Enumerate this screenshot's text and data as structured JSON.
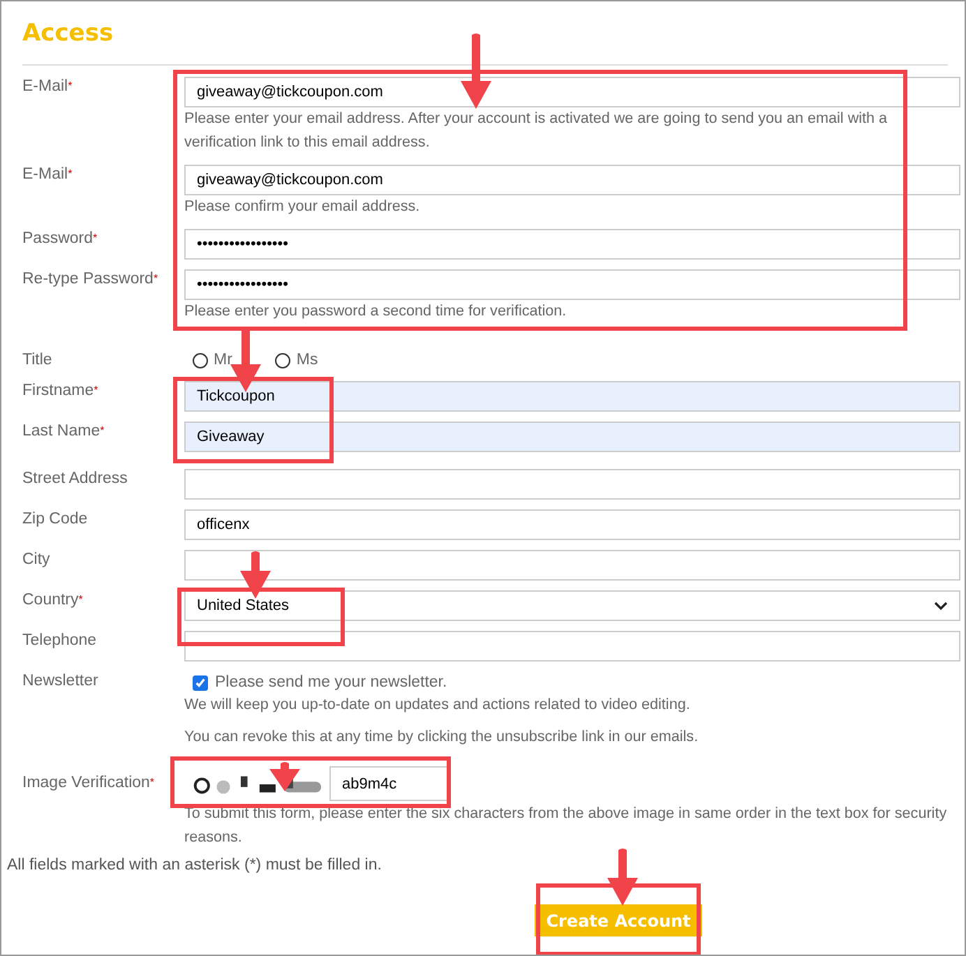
{
  "heading": "Access",
  "fields": [
    {
      "kind": "text",
      "label": "E-Mail",
      "asterisk": "*",
      "value": "giveaway@tickcoupon.com",
      "help": [
        "Please enter your email address. After your account is activated we are going to send you an email with a verification link to this email address."
      ]
    },
    {
      "kind": "text",
      "label": "E-Mail",
      "asterisk": "*",
      "value": "giveaway@tickcoupon.com",
      "help": [
        "Please confirm your email address."
      ]
    },
    {
      "kind": "password",
      "label": "Password",
      "asterisk": "*",
      "value": "•••••••••••••••••"
    },
    {
      "kind": "password",
      "label": "Re-type Password",
      "asterisk": "*",
      "value": "•••••••••••••••••",
      "help": [
        "Please enter you password a second time for verification."
      ]
    },
    {
      "kind": "radio",
      "label": "Title",
      "options": [
        {
          "label": "Mr",
          "selected": false
        },
        {
          "label": "Ms",
          "selected": false
        }
      ]
    },
    {
      "kind": "text",
      "label": "Firstname",
      "asterisk": "*",
      "value": "Tickcoupon",
      "autofilled": true
    },
    {
      "kind": "text",
      "label": "Last Name",
      "asterisk": "*",
      "value": "Giveaway",
      "autofilled": true
    },
    {
      "kind": "text",
      "label": "Street Address",
      "gap": true
    },
    {
      "kind": "text",
      "label": "Zip Code",
      "value": "officenx"
    },
    {
      "kind": "text",
      "label": "City"
    },
    {
      "kind": "select",
      "label": "Country",
      "asterisk": "*",
      "value": "United States"
    },
    {
      "kind": "text",
      "label": "Telephone"
    },
    {
      "kind": "checkbox",
      "label": "Newsletter",
      "text": "Please send me your newsletter.",
      "checked": true,
      "help": [
        "We will keep you up-to-date on updates and actions related to video editing.",
        "You can revoke this at any time by clicking the unsubscribe link in our emails."
      ]
    },
    {
      "kind": "captcha",
      "label": "Image Verification",
      "asterisk": "*",
      "value": "ab9m4c",
      "help": [
        "To submit this form, please enter the six characters from the above image in same order in the text box for security reasons."
      ]
    }
  ],
  "footnote": "All fields marked with an asterisk (*) must be filled in.",
  "submit": "Create Account"
}
